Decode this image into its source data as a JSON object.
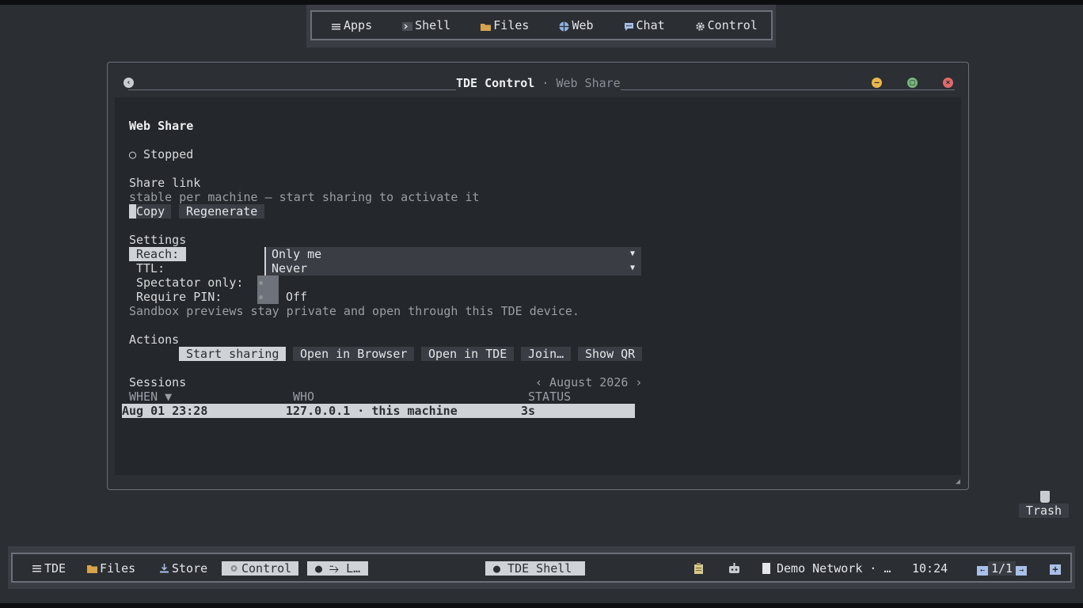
{
  "top_menu": {
    "items": [
      {
        "label": "Apps",
        "icon": "menu-icon"
      },
      {
        "label": "Shell",
        "icon": "terminal-icon"
      },
      {
        "label": "Files",
        "icon": "folder-icon"
      },
      {
        "label": "Web",
        "icon": "globe-icon"
      },
      {
        "label": "Chat",
        "icon": "chat-icon"
      },
      {
        "label": "Control",
        "icon": "gear-icon"
      }
    ]
  },
  "window": {
    "title_main": "TDE Control",
    "title_sep": " · ",
    "title_sub": "Web Share"
  },
  "web_share": {
    "heading": "Web Share",
    "status": "○ Stopped",
    "share_link": {
      "label": "Share link",
      "hint": "stable per machine — start sharing to activate it",
      "copy_label": "Copy",
      "regenerate_label": "Regenerate"
    },
    "settings": {
      "label": "Settings",
      "reach_label": "Reach:",
      "reach_value": "Only me",
      "ttl_label": "TTL:",
      "ttl_value": "Never",
      "spectator_label": "Spectator only:",
      "pin_label": "Require PIN:",
      "pin_state": "Off",
      "note": "Sandbox previews stay private and open through this TDE device."
    },
    "actions": {
      "label": "Actions",
      "start": "Start sharing",
      "open_browser": "Open in Browser",
      "open_tde": "Open in TDE",
      "join": "Join…",
      "show_qr": "Show QR"
    },
    "sessions": {
      "label": "Sessions",
      "month_nav": "‹ August 2026 ›",
      "columns": [
        "WHEN ▼",
        "WHO",
        "STATUS"
      ],
      "rows": [
        {
          "when": "Aug 01 23:28",
          "who": "127.0.0.1 · this machine",
          "status": "3s"
        }
      ]
    }
  },
  "desktop": {
    "trash_label": "Trash"
  },
  "taskbar": {
    "tde": "TDE",
    "files": "Files",
    "store": "Store",
    "control": "Control",
    "task_l": "● ⥲ L…",
    "task_shell": "● TDE Shell",
    "network": "Demo Network · …",
    "clock": "10:24",
    "workspace": "1/1"
  },
  "colors": {
    "background": "#2b2e33",
    "highlight": "#cfd2d6",
    "close": "#e06a6a",
    "minimize": "#e8b84a",
    "maximize": "#78b67e",
    "folder": "#d6a44c"
  }
}
